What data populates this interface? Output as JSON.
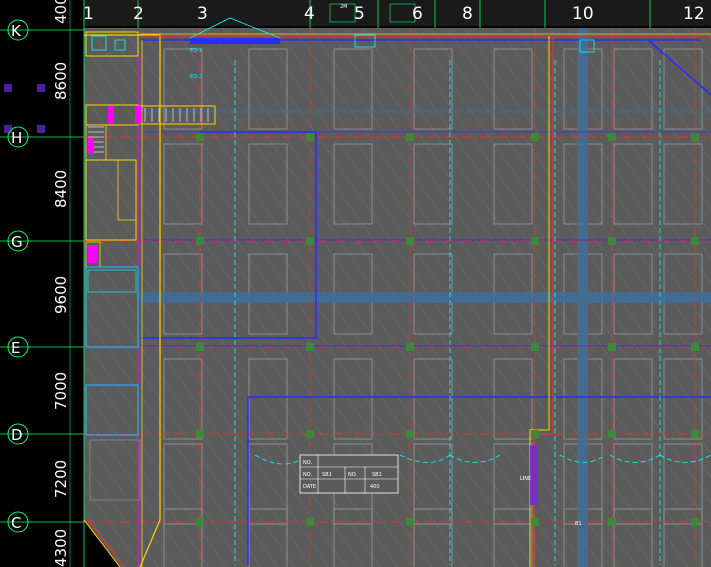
{
  "grid": {
    "columns": [
      "1",
      "2",
      "3",
      "4",
      "5",
      "6",
      "8",
      "10",
      "12"
    ],
    "rows": [
      "K",
      "H",
      "G",
      "E",
      "D",
      "C"
    ],
    "row_dims": [
      "400",
      "8600",
      "8400",
      "9600",
      "7000",
      "7200",
      "4300"
    ]
  },
  "colors": {
    "background": "#000000",
    "floor": "#5b5b5b",
    "grid_line": "#00ff66",
    "wall_yellow": "#ffd400",
    "wall_red": "#ff2b2b",
    "wall_blue": "#2b2bff",
    "cyan": "#00ffff",
    "magenta": "#ff00ff",
    "dim_text": "#ffffff",
    "steel_blue": "#3f6f9a"
  },
  "table": {
    "r1c1": "NO.",
    "r1c2": "",
    "r2c1": "NO.",
    "r2c2": "SB1",
    "r2c3": "NO.",
    "r2c4": "SB1",
    "r3c1": "DATE",
    "r3c2": "400",
    "top_label": "2M"
  },
  "tags": {
    "t1": "EQ-1",
    "t2": "EQ-2",
    "t3": "LINE",
    "t4": "B1"
  }
}
